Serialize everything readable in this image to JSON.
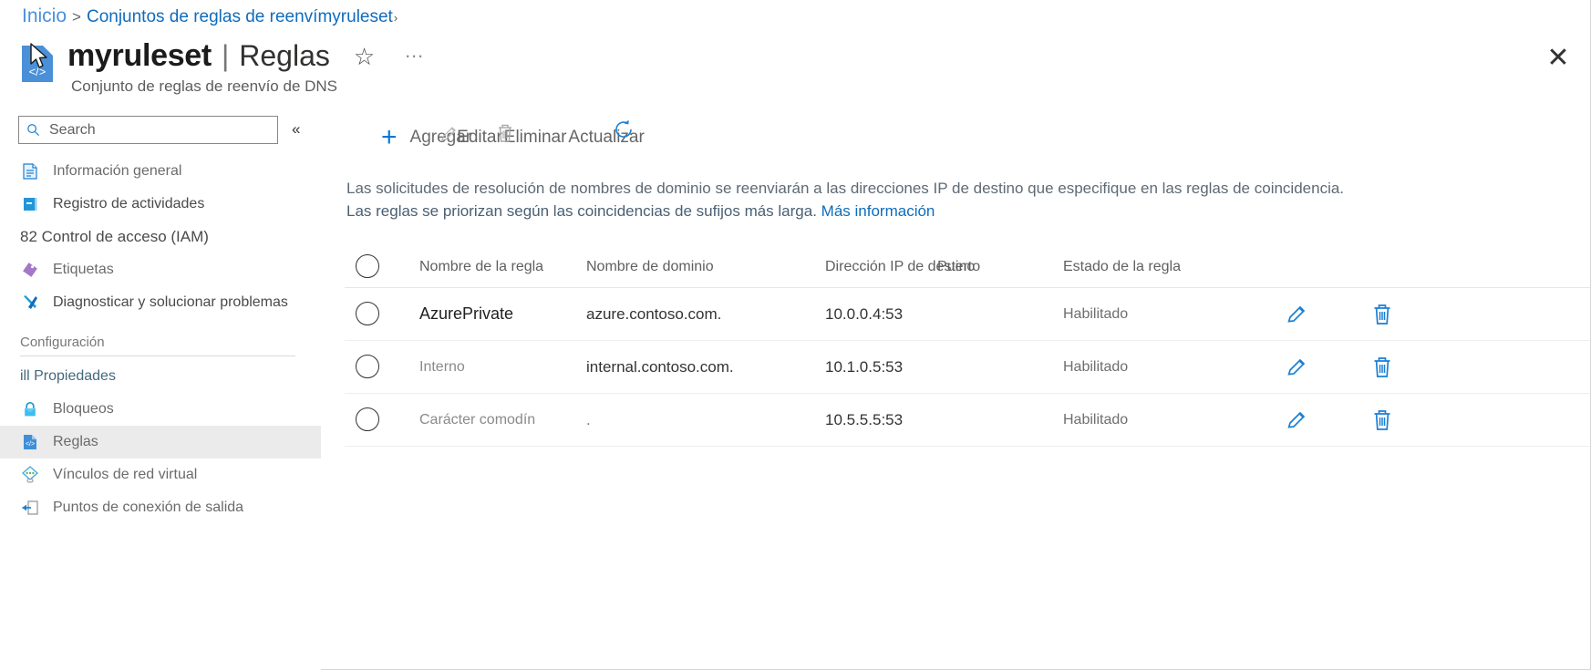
{
  "breadcrumb": {
    "home": "Inicio",
    "separator": ">",
    "parent": "Conjuntos de reglas de reenví",
    "current": "myruleset",
    "caret": "›"
  },
  "header": {
    "resource_name": "myruleset",
    "divider": "|",
    "section": "Reglas",
    "subtitle": "Conjunto de reglas de reenvío de DNS",
    "favorite_icon": "☆",
    "more_icon": "…",
    "close_icon": "✕"
  },
  "sidebar": {
    "search": {
      "value": "",
      "placeholder": "Search"
    },
    "collapse_icon": "«",
    "items": [
      {
        "label": "Información general",
        "icon": "overview-icon",
        "style": "dim",
        "selected": false
      },
      {
        "label": "Registro de actividades",
        "icon": "activity-log-icon",
        "style": "dark",
        "selected": false
      },
      {
        "label": "82 Control de acceso (IAM)",
        "icon": "access-control-icon",
        "style": "dark",
        "selected": false
      },
      {
        "label": "Etiquetas",
        "icon": "tags-icon",
        "style": "dim",
        "selected": false
      },
      {
        "label": "Diagnosticar y solucionar problemas",
        "icon": "troubleshoot-icon",
        "style": "dark",
        "selected": false
      }
    ],
    "section_label": "Configuración",
    "settings_items": [
      {
        "label": "ill Propiedades",
        "icon": "properties-icon",
        "style": "link",
        "selected": false
      },
      {
        "label": "Bloqueos",
        "icon": "lock-icon",
        "style": "dim",
        "selected": false
      },
      {
        "label": "Reglas",
        "icon": "rules-icon",
        "style": "dim",
        "selected": true
      },
      {
        "label": "Vínculos de red virtual",
        "icon": "vnet-links-icon",
        "style": "dim",
        "selected": false
      },
      {
        "label": "Puntos de conexión de salida",
        "icon": "outbound-endpoints-icon",
        "style": "dim",
        "selected": false
      }
    ]
  },
  "toolbar": {
    "add_label": "Agregar",
    "add_icon": "+",
    "edit_label": "Editar",
    "edit_icon": "pencil-icon",
    "delete_label": "Eliminar",
    "delete_icon": "trash-icon",
    "refresh_label": "Actualizar",
    "refresh_icon": "refresh-icon"
  },
  "description": {
    "line1": "Las solicitudes de resolución de nombres de dominio se reenviarán a las direcciones IP de destino que especifique en las reglas de coincidencia.",
    "line2": "Las reglas se priorizan según las coincidencias de sufijos más larga.",
    "link": "Más información"
  },
  "table": {
    "columns": [
      "Nombre de la regla",
      "Nombre de dominio",
      "Dirección IP de destino",
      "Puerto",
      "Estado de la regla"
    ],
    "rows": [
      {
        "name": "AzurePrivate",
        "domain": "azure.contoso.com.",
        "ip": "10.0.0.4:53",
        "state": "Habilitado",
        "name_style": "strong",
        "domain_style": "normal",
        "edit_icon": "pencil-icon",
        "delete_icon": "trash-icon"
      },
      {
        "name": "Interno",
        "domain": "internal.contoso.com.",
        "ip": "10.1.0.5:53",
        "state": "Habilitado",
        "name_style": "dim",
        "domain_style": "normal",
        "edit_icon": "pencil-icon",
        "delete_icon": "trash-icon"
      },
      {
        "name": "Carácter comodín",
        "domain": ".",
        "ip": "10.5.5.5:53",
        "state": "Habilitado",
        "name_style": "dim",
        "domain_style": "dim",
        "edit_icon": "pencil-icon",
        "delete_icon": "trash-icon"
      }
    ]
  },
  "colors": {
    "accent": "#0078d4",
    "link": "#0f6cbd",
    "selected_row_bg": "#ebebeb",
    "icon_blue": "#1a7fd4"
  }
}
